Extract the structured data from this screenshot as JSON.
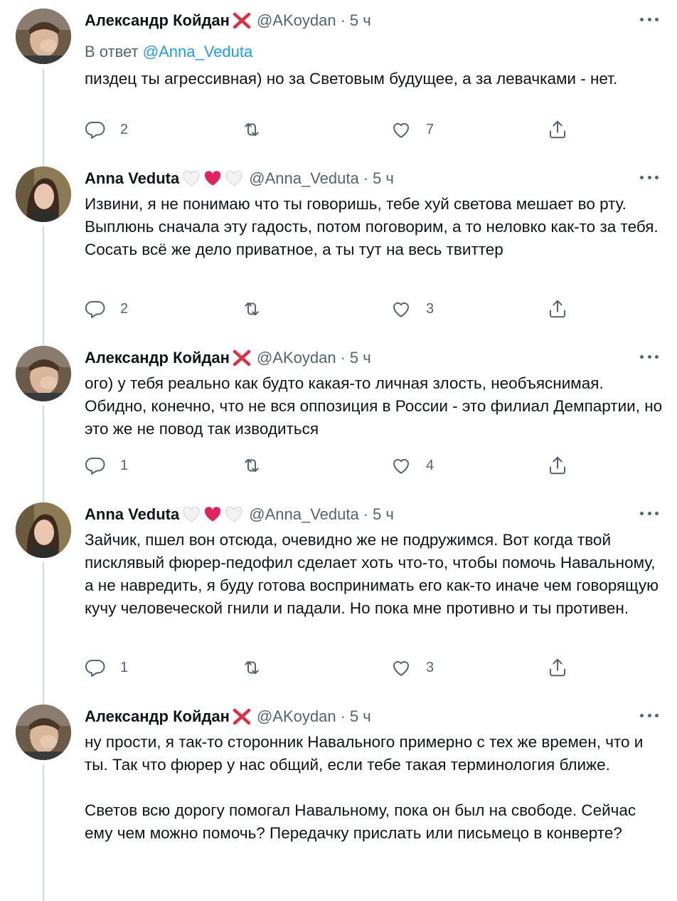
{
  "tweets": [
    {
      "author": "alexandr",
      "name": "Александр Койдан",
      "handle": "@AKoydan",
      "time": "5 ч",
      "reply_prefix": "В ответ ",
      "reply_to": "@Anna_Veduta",
      "text": "пиздец ты агрессивная) но за Световым будущее, а за левачками - нет.",
      "replies": "2",
      "retweets": "",
      "likes": "7"
    },
    {
      "author": "anna",
      "name": "Anna Veduta",
      "handle": "@Anna_Veduta",
      "time": "5 ч",
      "text": "Извини, я не понимаю что ты говоришь, тебе хуй светова мешает во рту. Выплюнь сначала эту гадость, потом поговорим, а то неловко как-то за тебя. Сосать всё же дело приватное, а ты тут на весь твиттер",
      "replies": "2",
      "retweets": "",
      "likes": "3"
    },
    {
      "author": "alexandr",
      "name": "Александр Койдан",
      "handle": "@AKoydan",
      "time": "5 ч",
      "text": "ого) у тебя реально как будто какая-то личная злость, необъяснимая. Обидно, конечно, что не вся оппозиция в России - это филиал Демпартии, но это же не повод так изводиться",
      "replies": "1",
      "retweets": "",
      "likes": "4"
    },
    {
      "author": "anna",
      "name": "Anna Veduta",
      "handle": "@Anna_Veduta",
      "time": "5 ч",
      "text": "Зайчик, пшел вон отсюда, очевидно же не подружимся. Вот когда твой писклявый фюрер-педофил сделает хоть что-то, чтобы помочь Навальному, а не навредить, я буду готова воспринимать его как-то иначе чем говорящую кучу человеческой гнили и падали. Но пока мне противно и ты противен.",
      "replies": "1",
      "retweets": "",
      "likes": "3"
    },
    {
      "author": "alexandr",
      "name": "Александр Койдан",
      "handle": "@AKoydan",
      "time": "5 ч",
      "text": "ну прости, я так-то сторонник Навального примерно с тех же времен, что и ты. Так что фюрер у нас общий, если тебе такая терминология ближе.\n\nСветов всю дорогу помогал Навальному, пока он был на свободе. Сейчас ему чем можно помочь? Передачку прислать или письмецо в конверте?"
    }
  ],
  "icons": {
    "name_emoji_alexandr": [
      "cross-mark-icon"
    ],
    "name_emoji_anna": [
      "white-heart-icon",
      "red-heart-icon",
      "white-heart-icon"
    ],
    "actions": [
      "reply-icon",
      "retweet-icon",
      "like-icon",
      "share-icon"
    ]
  },
  "colors": {
    "link": "#1d9bf0",
    "secondary_text": "#536471",
    "heart_red": "#e0245e",
    "cross_red": "#dd2e44"
  }
}
